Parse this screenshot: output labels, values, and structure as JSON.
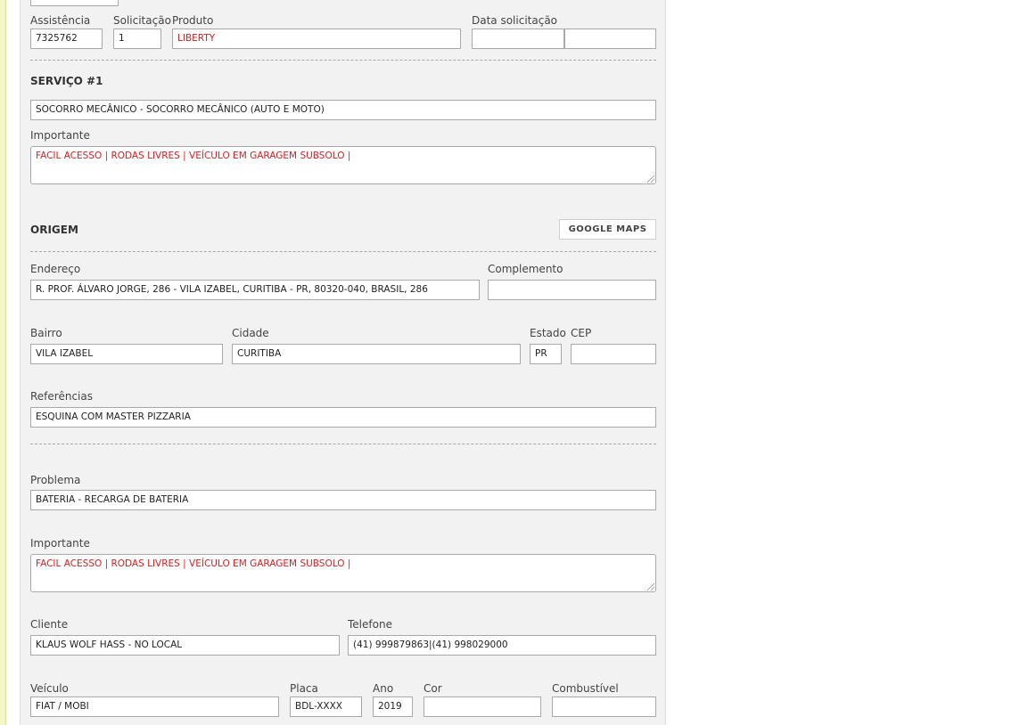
{
  "header": {
    "assistencia_label": "Assistência",
    "assistencia_value": "7325762",
    "solicitacao_label": "Solicitação",
    "solicitacao_value": "1",
    "produto_label": "Produto",
    "produto_value": "LIBERTY",
    "data_solicitacao_label": "Data solicitação",
    "data_solicitacao_value_1": "",
    "data_solicitacao_value_2": ""
  },
  "servico": {
    "title": "SERVIÇO #1",
    "description": "SOCORRO MECÂNICO - SOCORRO MECÂNICO (AUTO E MOTO)",
    "importante_label": "Importante",
    "importante_value": "FACIL ACESSO | RODAS LIVRES |  VEÍCULO EM GARAGEM SUBSOLO |"
  },
  "origem": {
    "title": "ORIGEM",
    "google_maps_button": "GOOGLE MAPS",
    "endereco_label": "Endereço",
    "endereco_value": "R. PROF. ÁLVARO JORGE, 286 - VILA IZABEL, CURITIBA - PR, 80320-040, BRASIL, 286",
    "complemento_label": "Complemento",
    "complemento_value": "",
    "bairro_label": "Bairro",
    "bairro_value": "VILA IZABEL",
    "cidade_label": "Cidade",
    "cidade_value": "CURITIBA",
    "estado_label": "Estado",
    "estado_value": "PR",
    "cep_label": "CEP",
    "cep_value": "",
    "referencias_label": "Referências",
    "referencias_value": "ESQUINA COM MASTER PIZZARIA"
  },
  "problema": {
    "problema_label": "Problema",
    "problema_value": "BATERIA - RECARGA DE BATERIA",
    "importante_label": "Importante",
    "importante_value": "FACIL ACESSO | RODAS LIVRES |  VEÍCULO EM GARAGEM SUBSOLO |"
  },
  "cliente": {
    "cliente_label": "Cliente",
    "cliente_value": "KLAUS WOLF HASS - NO LOCAL",
    "telefone_label": "Telefone",
    "telefone_value": "(41) 999879863|(41) 998029000"
  },
  "veiculo": {
    "veiculo_label": "Veículo",
    "veiculo_value": "FIAT / MOBI",
    "placa_label": "Placa",
    "placa_value": "BDL-XXXX",
    "ano_label": "Ano",
    "ano_value": "2019",
    "cor_label": "Cor",
    "cor_value": "",
    "combustivel_label": "Combustível",
    "combustivel_value": ""
  },
  "colors": {
    "panel_background": "#f2f2f2",
    "alert_text": "#d42020",
    "left_strip": "#f3f7c9"
  }
}
